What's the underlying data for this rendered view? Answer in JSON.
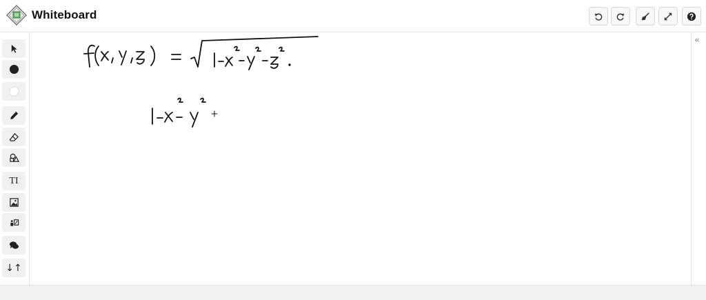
{
  "app": {
    "title": "Whiteboard",
    "logo_icon": "whiteboard-logo-icon"
  },
  "header_buttons": [
    {
      "name": "undo-button",
      "icon": "undo-icon"
    },
    {
      "name": "redo-button",
      "icon": "redo-icon"
    },
    {
      "name": "clear-button",
      "icon": "broom-icon"
    },
    {
      "name": "fullscreen-button",
      "icon": "expand-icon"
    },
    {
      "name": "help-button",
      "icon": "help-icon"
    }
  ],
  "toolbar": {
    "items": [
      {
        "name": "select-tool",
        "icon": "pointer-icon"
      },
      {
        "name": "color-black-tool",
        "icon": "black-circle-icon",
        "color": "#222222"
      },
      {
        "name": "color-white-tool",
        "icon": "white-circle-icon",
        "color": "#ffffff"
      },
      {
        "name": "pen-tool",
        "icon": "pencil-icon"
      },
      {
        "name": "eraser-tool",
        "icon": "eraser-icon"
      },
      {
        "name": "shapes-tool",
        "icon": "shapes-icon"
      },
      {
        "name": "text-tool",
        "icon": "text-icon",
        "label": "TI"
      },
      {
        "name": "image-tool",
        "icon": "image-icon"
      },
      {
        "name": "insert-tool",
        "icon": "insert-icon"
      },
      {
        "name": "chat-tool",
        "icon": "chat-icon"
      },
      {
        "name": "sort-tool",
        "icon": "up-down-arrows-icon",
        "label": "↓↑"
      }
    ]
  },
  "canvas": {
    "handwriting": [
      "f(x,y,z) = √(1−x²−y²−z²).",
      "1−x²−y²"
    ]
  },
  "right_panel": {
    "collapse_label": "«"
  },
  "colors": {
    "accent": "#222222",
    "border": "#e2e2e2"
  }
}
